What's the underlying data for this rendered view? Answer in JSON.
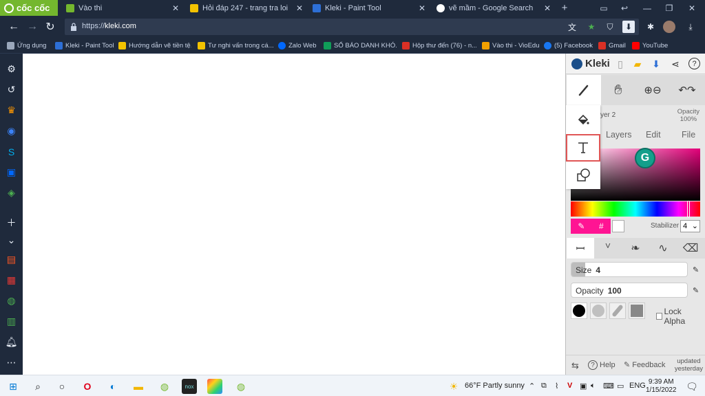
{
  "browser": {
    "brand": "cốc cốc",
    "tabs": [
      {
        "label": "Vào thi",
        "color": "#74b72e"
      },
      {
        "label": "Hỏi đáp 247 - trang tra loi",
        "color": "#f2c200"
      },
      {
        "label": "Kleki - Paint Tool",
        "color": "#2d6fd6"
      },
      {
        "label": "vẽ mầm - Google Search",
        "color": "#ffffff"
      }
    ],
    "url_prefix": "https://",
    "url_host": "kleki.com"
  },
  "bookmarks": [
    {
      "label": "Ứng dụng",
      "color": "#9aa7bb"
    },
    {
      "label": "Kleki - Paint Tool",
      "color": "#2d6fd6"
    },
    {
      "label": "Hướng dẫn vẽ tiền tệ...",
      "color": "#f2c200"
    },
    {
      "label": "Tư nghi vấn trong cá...",
      "color": "#f2c200"
    },
    {
      "label": "Zalo Web",
      "color": "#0068ff"
    },
    {
      "label": "SỔ BÁO DANH KHÓ...",
      "color": "#0f9d58"
    },
    {
      "label": "Hộp thư đến (76) - n...",
      "color": "#d93025"
    },
    {
      "label": "Vào thi - VioEdu",
      "color": "#f2a000"
    },
    {
      "label": "(5) Facebook",
      "color": "#1877f2"
    },
    {
      "label": "Gmail",
      "color": "#d93025"
    },
    {
      "label": "YouTube",
      "color": "#ff0000"
    }
  ],
  "kleki": {
    "logo": "Kleki",
    "layer_name": "yer 2",
    "opacity_label": "Opacity",
    "opacity_value": "100%",
    "subtabs": [
      "Layers",
      "Edit",
      "File"
    ],
    "hash_label": "#",
    "grammarly": "G",
    "stabilizer_label": "Stabilizer",
    "stabilizer_value": "4",
    "size_label": "Size",
    "size_value": "4",
    "size_fraction": 0.12,
    "brush_opacity_label": "Opacity",
    "brush_opacity_value": "100",
    "lock_alpha": "Lock Alpha",
    "help": "Help",
    "feedback": "Feedback",
    "updated_line1": "updated",
    "updated_line2": "yesterday",
    "primary_color": "#ff1493"
  },
  "taskbar": {
    "weather": "66°F  Partly sunny",
    "lang": "ENG",
    "time": "9:39 AM",
    "date": "1/15/2022"
  }
}
